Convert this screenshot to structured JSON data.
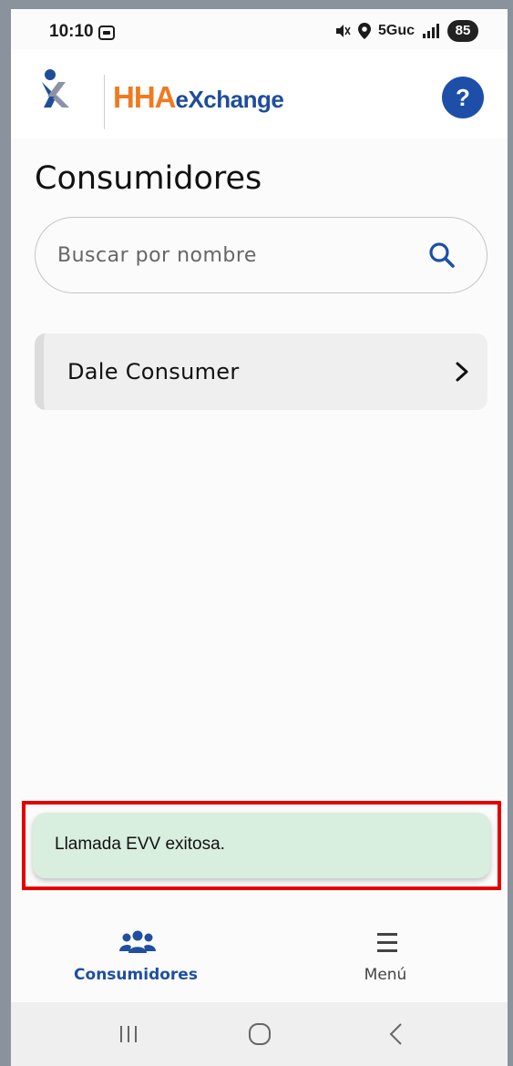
{
  "status_bar": {
    "time": "10:10",
    "network": "5Guc",
    "battery": "85"
  },
  "header": {
    "brand_hha": "HHA",
    "brand_exchange": "eXchange",
    "help_label": "?"
  },
  "page": {
    "title": "Consumidores"
  },
  "search": {
    "placeholder": "Buscar por nombre",
    "value": ""
  },
  "consumers": [
    {
      "name": "Dale Consumer"
    }
  ],
  "toast": {
    "message": "Llamada EVV exitosa."
  },
  "bottom_nav": {
    "items": [
      {
        "label": "Consumidores",
        "icon": "people-icon",
        "active": true
      },
      {
        "label": "Menú",
        "icon": "hamburger-menu-icon",
        "active": false
      }
    ]
  },
  "colors": {
    "brand_orange": "#f07a21",
    "brand_blue": "#1e4d9a",
    "toast_bg": "#d8eedf",
    "highlight": "#e60000"
  }
}
